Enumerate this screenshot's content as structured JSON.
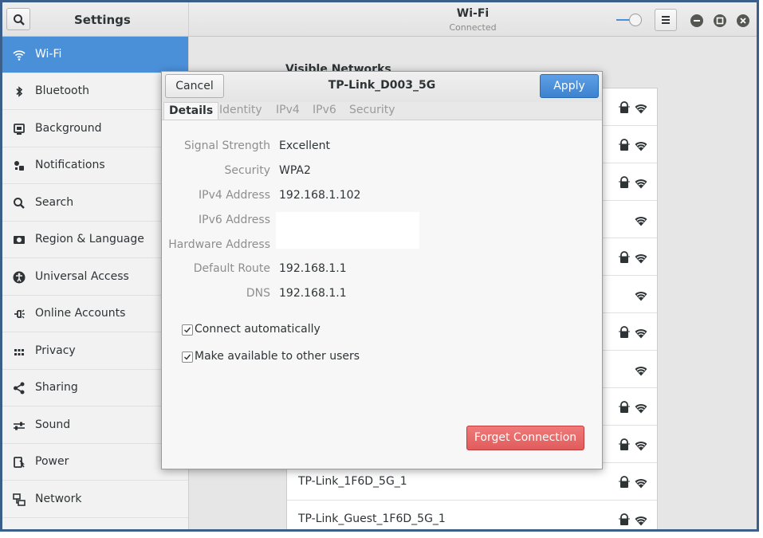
{
  "header": {
    "settings_title": "Settings",
    "panel_title": "Wi-Fi",
    "panel_subtitle": "Connected"
  },
  "sidebar": {
    "items": [
      {
        "label": "Wi-Fi",
        "icon": "wifi-icon",
        "selected": true
      },
      {
        "label": "Bluetooth",
        "icon": "bluetooth-icon"
      },
      {
        "label": "Background",
        "icon": "background-icon"
      },
      {
        "label": "Notifications",
        "icon": "notifications-icon"
      },
      {
        "label": "Search",
        "icon": "search-icon"
      },
      {
        "label": "Region & Language",
        "icon": "region-icon"
      },
      {
        "label": "Universal Access",
        "icon": "universal-access-icon"
      },
      {
        "label": "Online Accounts",
        "icon": "online-accounts-icon"
      },
      {
        "label": "Privacy",
        "icon": "privacy-icon"
      },
      {
        "label": "Sharing",
        "icon": "sharing-icon"
      },
      {
        "label": "Sound",
        "icon": "sound-icon"
      },
      {
        "label": "Power",
        "icon": "power-icon"
      },
      {
        "label": "Network",
        "icon": "network-icon"
      }
    ]
  },
  "main": {
    "visible_networks_label": "Visible Networks",
    "networks": [
      {
        "name": "",
        "secured": true
      },
      {
        "name": "",
        "secured": true
      },
      {
        "name": "",
        "secured": true
      },
      {
        "name": "",
        "secured": false
      },
      {
        "name": "",
        "secured": true
      },
      {
        "name": "",
        "secured": false
      },
      {
        "name": "",
        "secured": true
      },
      {
        "name": "",
        "secured": false
      },
      {
        "name": "",
        "secured": true
      },
      {
        "name": "",
        "secured": true
      },
      {
        "name": "TP-Link_1F6D_5G_1",
        "secured": true
      },
      {
        "name": "TP-Link_Guest_1F6D_5G_1",
        "secured": true
      }
    ]
  },
  "dialog": {
    "title": "TP-Link_D003_5G",
    "cancel_label": "Cancel",
    "apply_label": "Apply",
    "tabs": [
      "Details",
      "Identity",
      "IPv4",
      "IPv6",
      "Security"
    ],
    "active_tab": "Details",
    "fields": {
      "signal_strength": {
        "label": "Signal Strength",
        "value": "Excellent"
      },
      "security": {
        "label": "Security",
        "value": "WPA2"
      },
      "ipv4": {
        "label": "IPv4 Address",
        "value": "192.168.1.102"
      },
      "ipv6": {
        "label": "IPv6 Address",
        "value": ""
      },
      "hardware": {
        "label": "Hardware Address",
        "value": ""
      },
      "route": {
        "label": "Default Route",
        "value": "192.168.1.1"
      },
      "dns": {
        "label": "DNS",
        "value": "192.168.1.1"
      }
    },
    "connect_auto": {
      "label": "Connect automatically",
      "checked": true
    },
    "available_all": {
      "label": "Make available to other users",
      "checked": true
    },
    "forget_label": "Forget Connection"
  },
  "colors": {
    "accent": "#4a90d9",
    "destructive": "#e05c5c"
  }
}
